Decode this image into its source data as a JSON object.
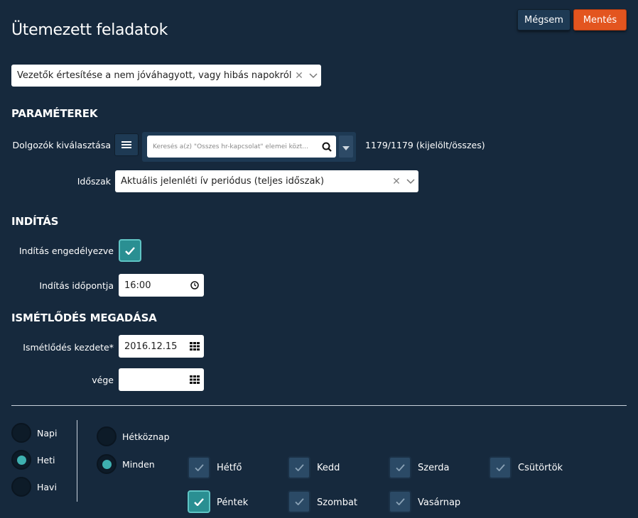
{
  "header": {
    "title": "Ütemezett feladatok",
    "cancel_label": "Mégsem",
    "save_label": "Mentés"
  },
  "task_select": {
    "value": "Vezetők értesítése a nem jóváhagyott, vagy hibás napokról"
  },
  "parameters": {
    "heading": "PARAMÉTEREK",
    "employees_label": "Dolgozók kiválasztása",
    "search_placeholder": "Keresés a(z) \"Összes hr-kapcsolat\" elemei közt...",
    "selection_count": "1179/1179 (kijelölt/összes)",
    "period_label": "Időszak",
    "period_value": "Aktuális jelenléti ív periódus (teljes időszak)"
  },
  "start": {
    "heading": "INDÍTÁS",
    "enabled_label": "Indítás engedélyezve",
    "enabled": true,
    "time_label": "Indítás időpontja",
    "time_value": "16:00"
  },
  "repeat": {
    "heading": "ISMÉTLŐDÉS MEGADÁSA",
    "start_label": "Ismétlődés kezdete*",
    "start_value": "2016.12.15",
    "end_label": "vége",
    "end_value": ""
  },
  "frequency": {
    "options": [
      {
        "label": "Napi",
        "selected": false
      },
      {
        "label": "Heti",
        "selected": true
      },
      {
        "label": "Havi",
        "selected": false
      }
    ]
  },
  "day_mode": {
    "options": [
      {
        "label": "Hétköznap",
        "selected": false
      },
      {
        "label": "Minden",
        "selected": true
      }
    ]
  },
  "days": [
    {
      "label": "Hétfő",
      "checked": false
    },
    {
      "label": "Kedd",
      "checked": false
    },
    {
      "label": "Szerda",
      "checked": false
    },
    {
      "label": "Csütörtök",
      "checked": false
    },
    {
      "label": "Péntek",
      "checked": true
    },
    {
      "label": "Szombat",
      "checked": false
    },
    {
      "label": "Vasárnap",
      "checked": false
    }
  ],
  "colors": {
    "background": "#16293d",
    "accent": "#2a8f92",
    "save": "#e3551f"
  }
}
